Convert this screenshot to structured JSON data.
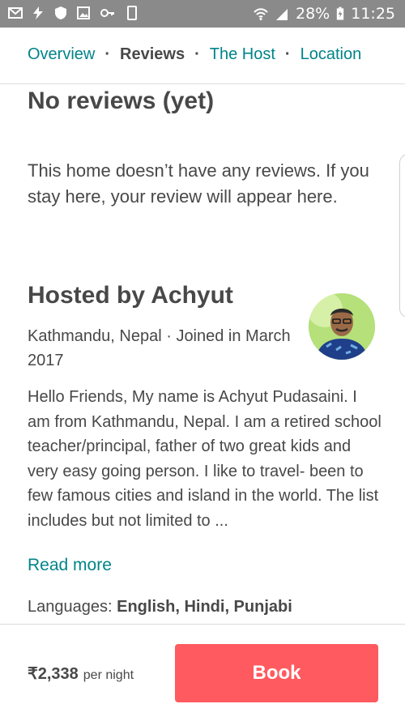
{
  "status_bar": {
    "battery": "28%",
    "time": "11:25",
    "left_icons": [
      "mail-icon",
      "flash-icon",
      "shield-icon",
      "image-icon",
      "key-icon",
      "phone-icon"
    ],
    "right_icons": [
      "wifi-icon",
      "signal-icon",
      "battery-icon"
    ]
  },
  "tabs": {
    "items": [
      {
        "label": "Overview",
        "active": false
      },
      {
        "label": "Reviews",
        "active": true
      },
      {
        "label": "The Host",
        "active": false
      },
      {
        "label": "Location",
        "active": false
      }
    ],
    "separator": "·"
  },
  "reviews": {
    "heading": "No reviews (yet)",
    "text": "This home doesn’t have any reviews. If you stay here, your review will appear here."
  },
  "host": {
    "heading": "Hosted by Achyut",
    "meta": "Kathmandu, Nepal · Joined in March 2017",
    "bio": "Hello Friends,  My name is Achyut Pudasaini. I am from Kathmandu, Nepal. I am a retired school teacher/principal, father of two great kids and very easy going person. I like to travel- been to few famous cities and island in the world. The list includes but not limited to ...",
    "read_more": "Read more",
    "languages_label": "Languages: ",
    "languages": "English, Hindi, Punjabi"
  },
  "booking": {
    "price": "₹2,338",
    "per": "per night",
    "button": "Book"
  },
  "colors": {
    "accent": "#008489",
    "book": "#ff5a5f",
    "text": "#484848",
    "status_bar": "#8a8a8a"
  }
}
